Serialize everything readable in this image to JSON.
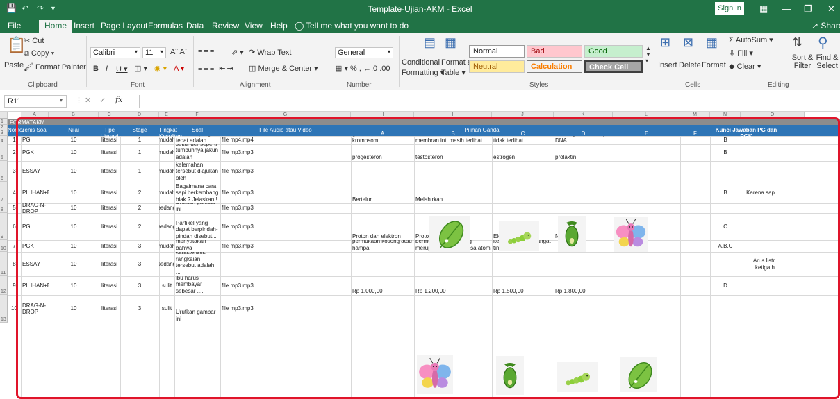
{
  "window": {
    "title": "Template-Ujian-AKM  -  Excel",
    "signin": "Sign in"
  },
  "tabs": [
    "File",
    "Home",
    "Insert",
    "Page Layout",
    "Formulas",
    "Data",
    "Review",
    "View",
    "Help"
  ],
  "tell_me": "Tell me what you want to do",
  "share": "Share",
  "ribbon": {
    "cut": "Cut",
    "copy": "Copy",
    "paste": "Paste",
    "format_painter": "Format Painter",
    "font_name": "Calibri",
    "font_size": "11",
    "wrap_text": "Wrap Text",
    "merge_center": "Merge & Center",
    "number_format": "General",
    "conditional": "Conditional",
    "formatting": "Formatting",
    "format_as": "Format as",
    "table": "Table",
    "styles": {
      "normal": "Normal",
      "bad": "Bad",
      "good": "Good",
      "neutral": "Neutral",
      "calculation": "Calculation",
      "check_cell": "Check Cell"
    },
    "insert": "Insert",
    "delete": "Delete",
    "format": "Format",
    "autosum": "AutoSum",
    "fill": "Fill",
    "clear": "Clear",
    "sort_filter": "Sort & Filter",
    "find_select": "Find & Select",
    "groups": {
      "clipboard": "Clipboard",
      "font": "Font",
      "alignment": "Alignment",
      "number": "Number",
      "styles": "Styles",
      "cells": "Cells",
      "editing": "Editing"
    }
  },
  "formula_bar": {
    "name_box": "R11",
    "fx": "fx",
    "value": ""
  },
  "sheet": {
    "columns": [
      "A",
      "B",
      "C",
      "D",
      "E",
      "F",
      "G",
      "H",
      "I",
      "J",
      "K",
      "L",
      "M",
      "N",
      "O"
    ],
    "title_row": {
      "format": "FORMAT",
      "akm": "AKM"
    },
    "headers": {
      "nomor": "Nomor",
      "jenis": "Jenis Soal",
      "nilai": "Nilai",
      "tipe": "Tipe Literasi",
      "stage": "Stage",
      "tingkat": "Tingkat Kesulitan",
      "soal": "Soal",
      "audio": "File Audio atau Video",
      "pilihan": "Pilihan Ganda",
      "kunci": "Kunci Jawaban PG dan PGK",
      "a": "A",
      "b": "B",
      "c": "C",
      "d": "D",
      "e": "E",
      "f": "F"
    },
    "rows": [
      {
        "row": "4",
        "no": "1",
        "jenis": "PG",
        "nilai": "10",
        "tipe": "literasi",
        "stage": "1",
        "tingkat": "mudah",
        "soal": "Karakteristik sel pada fase interfase yang tepat adalah....",
        "file": "file mp4.mp4",
        "a": "terbentuknya materi genetik dalam bentuk kromosom",
        "b": "membran inti masih terlihat",
        "c": "nukleus dan nukleolus tidak terlihat",
        "d": "terjadi pengurangan materi genetik berupa DNA",
        "kunci": "B",
        "extra": ""
      },
      {
        "row": "5",
        "no": "2",
        "jenis": "PGK",
        "nilai": "10",
        "tipe": "literasi",
        "stage": "1",
        "tingkat": "mudah",
        "soal": "Hormon yang berfungsi dalam spermatogenesis dan memunculkan tanda-tanda kelamin sekunder seperti tumbuhnya jakun adalah",
        "file": "file mp3.mp3",
        "a": "progesteron",
        "b": "testosteron",
        "c": "estrogen",
        "d": "prolaktin",
        "kunci": "B",
        "extra": ""
      },
      {
        "row": "6",
        "no": "3",
        "jenis": "ESSAY",
        "nilai": "10",
        "tipe": "literasi",
        "stage": "1",
        "tingkat": "mudah",
        "soal": "Suatu model atom yang diajukan memiliki kelemahan bahwa model atom ini belum mampu menjelaskan di mana letak elektron dan cara rotasinya terhadap inti atom. Model atom yang memiliki kelemahan tersebut diajukan oleh",
        "file": "file mp3.mp3",
        "a": "",
        "b": "",
        "c": "",
        "d": "",
        "kunci": "",
        "extra": ""
      },
      {
        "row": "7",
        "no": "4",
        "jenis": "PILIHAN+ESSAY",
        "nilai": "10",
        "tipe": "literasi",
        "stage": "2",
        "tingkat": "mudah",
        "soal": "Bagaimana cara sapi berkembang biak ? Jelaskan !",
        "file": "file mp3.mp3",
        "a": "Bertelur",
        "b": "Melahirkan",
        "c": "",
        "d": "",
        "kunci": "B",
        "extra": "Karena sap"
      },
      {
        "row": "8",
        "no": "5",
        "jenis": "DRAG-N-DROP",
        "nilai": "10",
        "tipe": "literasi",
        "stage": "2",
        "tingkat": "sedang",
        "soal": "Urutkan gambar ini",
        "file": "file mp3.mp3",
        "a": "",
        "b": "",
        "c": "",
        "d": "",
        "kunci": "",
        "extra": ""
      },
      {
        "row": "9",
        "no": "6",
        "jenis": "PG",
        "nilai": "10",
        "tipe": "literasi",
        "stage": "2",
        "tingkat": "sedang",
        "soal": "Partikel yang dapat berpindah-pindah disebut...",
        "file": "file mp3.mp3",
        "a": "Proton dan elektron",
        "b": "Proton",
        "c": "Elektron",
        "d": "Neutron",
        "kunci": "C",
        "extra": ""
      },
      {
        "row": "10",
        "no": "7",
        "jenis": "PGK",
        "nilai": "10",
        "tipe": "literasi",
        "stage": "3",
        "tingkat": "mudah",
        "soal": "Model atom Rutherford menyatakan bahwa",
        "file": "file mp3.mp3",
        "a": "Sebagian besar dari atom merupakan permukaan kosong atau hampa",
        "b": "Atom memiliki inti atom bermuatan positif yang merupakan pusat massa atom",
        "c": "Elektron bergerak mengelilingi inti dengan kecepatan yang sangat tinggi",
        "d": "",
        "kunci": "A,B,C",
        "extra": ""
      },
      {
        "row": "11",
        "no": "8",
        "jenis": "ESSAY",
        "nilai": "10",
        "tipe": "literasi",
        "stage": "3",
        "tingkat": "sedang",
        "soal": "Tiga buah hambatan listrik dipasang secara berdampingan. Pernyataan yang tepat mengenai karakteristik rangkaian tersebut adalah ...",
        "file": "",
        "a": "",
        "b": "",
        "c": "",
        "d": "",
        "kunci": "",
        "extra": "Arus listr ketiga h"
      },
      {
        "row": "12",
        "no": "9",
        "jenis": "PILIHAN+ESSAY",
        "nilai": "10",
        "tipe": "literasi",
        "stage": "3",
        "tingkat": "sulit",
        "soal": "Ibu memasak menggunakan rice cooker berdaya 40 watt selama 1 jam setiap harinya. Jika biaya listrik per kWh sebesar Rp 1.500,00, setiap bulannya ibu harus membayar sebesar ....",
        "file": "file mp3.mp3",
        "a": "Rp 1.000,00",
        "b": "Rp 1.200,00",
        "c": "Rp 1.500,00",
        "d": "Rp 1.800,00",
        "kunci": "D",
        "extra": ""
      },
      {
        "row": "13",
        "no": "10",
        "jenis": "DRAG-N-DROP",
        "nilai": "10",
        "tipe": "literasi",
        "stage": "3",
        "tingkat": "sulit",
        "soal": "Urutkan gambar ini",
        "file": "file mp3.mp3",
        "a": "",
        "b": "",
        "c": "",
        "d": "",
        "kunci": "",
        "extra": ""
      }
    ],
    "row_numbers": [
      "1",
      "2",
      "3"
    ]
  }
}
